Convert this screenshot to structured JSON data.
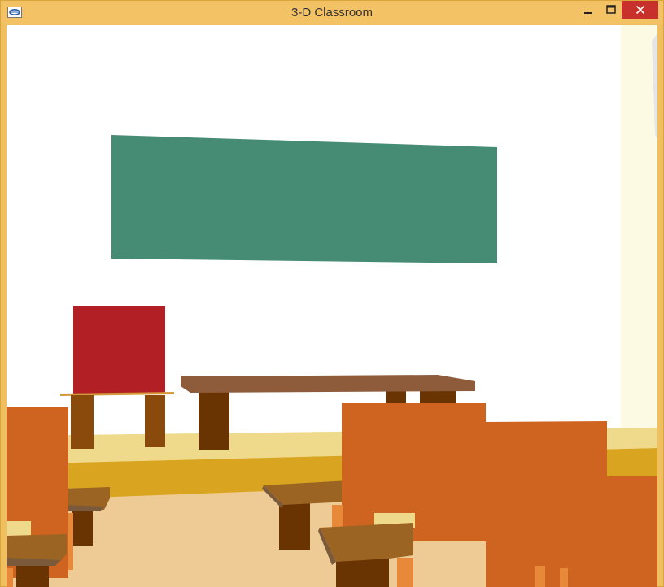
{
  "window": {
    "title": "3-D Classroom",
    "icons": {
      "app": "glut-app-icon",
      "minimize": "minimize-icon",
      "maximize": "maximize-icon",
      "close": "close-icon"
    }
  },
  "scene": {
    "objects": [
      "wall",
      "chalkboard",
      "teacher-chair",
      "teacher-desk",
      "stage",
      "floor",
      "student-desks",
      "student-chairs"
    ],
    "colors": {
      "wall": "#ffffff",
      "side_wall": "#fdfae3",
      "chalkboard": "#468b73",
      "chair_back_red": "#b22025",
      "chair_leg": "#8a4a0c",
      "desk_top": "#8e5b3b",
      "desk_leg": "#6a3402",
      "stage_top": "#efd98a",
      "stage_front": "#d9a521",
      "floor": "#eecb94",
      "student_chair": "#cf6320",
      "student_desk": "#9b6422"
    }
  }
}
